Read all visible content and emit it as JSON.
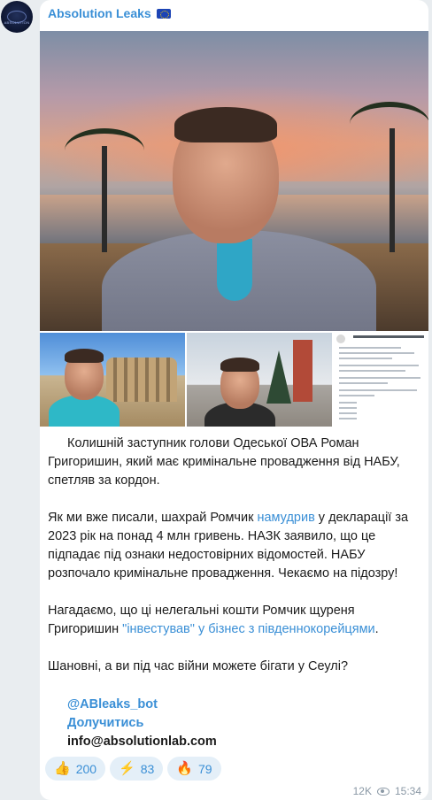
{
  "channel": {
    "name": "Absolution Leaks",
    "flag_icon": "eu-flag-icon",
    "avatar_text": "ABSOLUTION"
  },
  "post": {
    "para1": "Колишній заступник голови Одеської ОВА Роман Григоришин, який має кримінальне провадження від НАБУ, спетляв за кордон.",
    "para2_before": "Як ми вже писали, шахрай Ромчик ",
    "para2_link": "намудрив",
    "para2_after": " у декларації за 2023 рік на понад 4 млн гривень. НАЗК заявило, що це підпадає під ознаки недостовірних відомостей. НАБУ розпочало кримінальне провадження. Чекаємо на підозру!",
    "para3_before": "Нагадаємо, що ці нелегальні кошти Ромчик щуреня Григоришин ",
    "para3_link": "\"інвестував\" у бізнес з південнокорейцями",
    "para3_after": ".",
    "para4": "Шановні, а ви під час війни можете бігати у Сеулі?",
    "bot_link": "@ABleaks_bot",
    "join_link": "Долучитись",
    "email": "info@absolutionlab.com"
  },
  "reactions": [
    {
      "emoji": "👍",
      "count": "200"
    },
    {
      "emoji": "⚡",
      "count": "83"
    },
    {
      "emoji": "🔥",
      "count": "79"
    }
  ],
  "meta": {
    "views": "12K",
    "time": "15:34"
  },
  "colors": {
    "accent": "#3a8fd6",
    "bubble": "#ffffff",
    "background": "#e9edf0",
    "reaction_bg": "#e4eff8"
  }
}
